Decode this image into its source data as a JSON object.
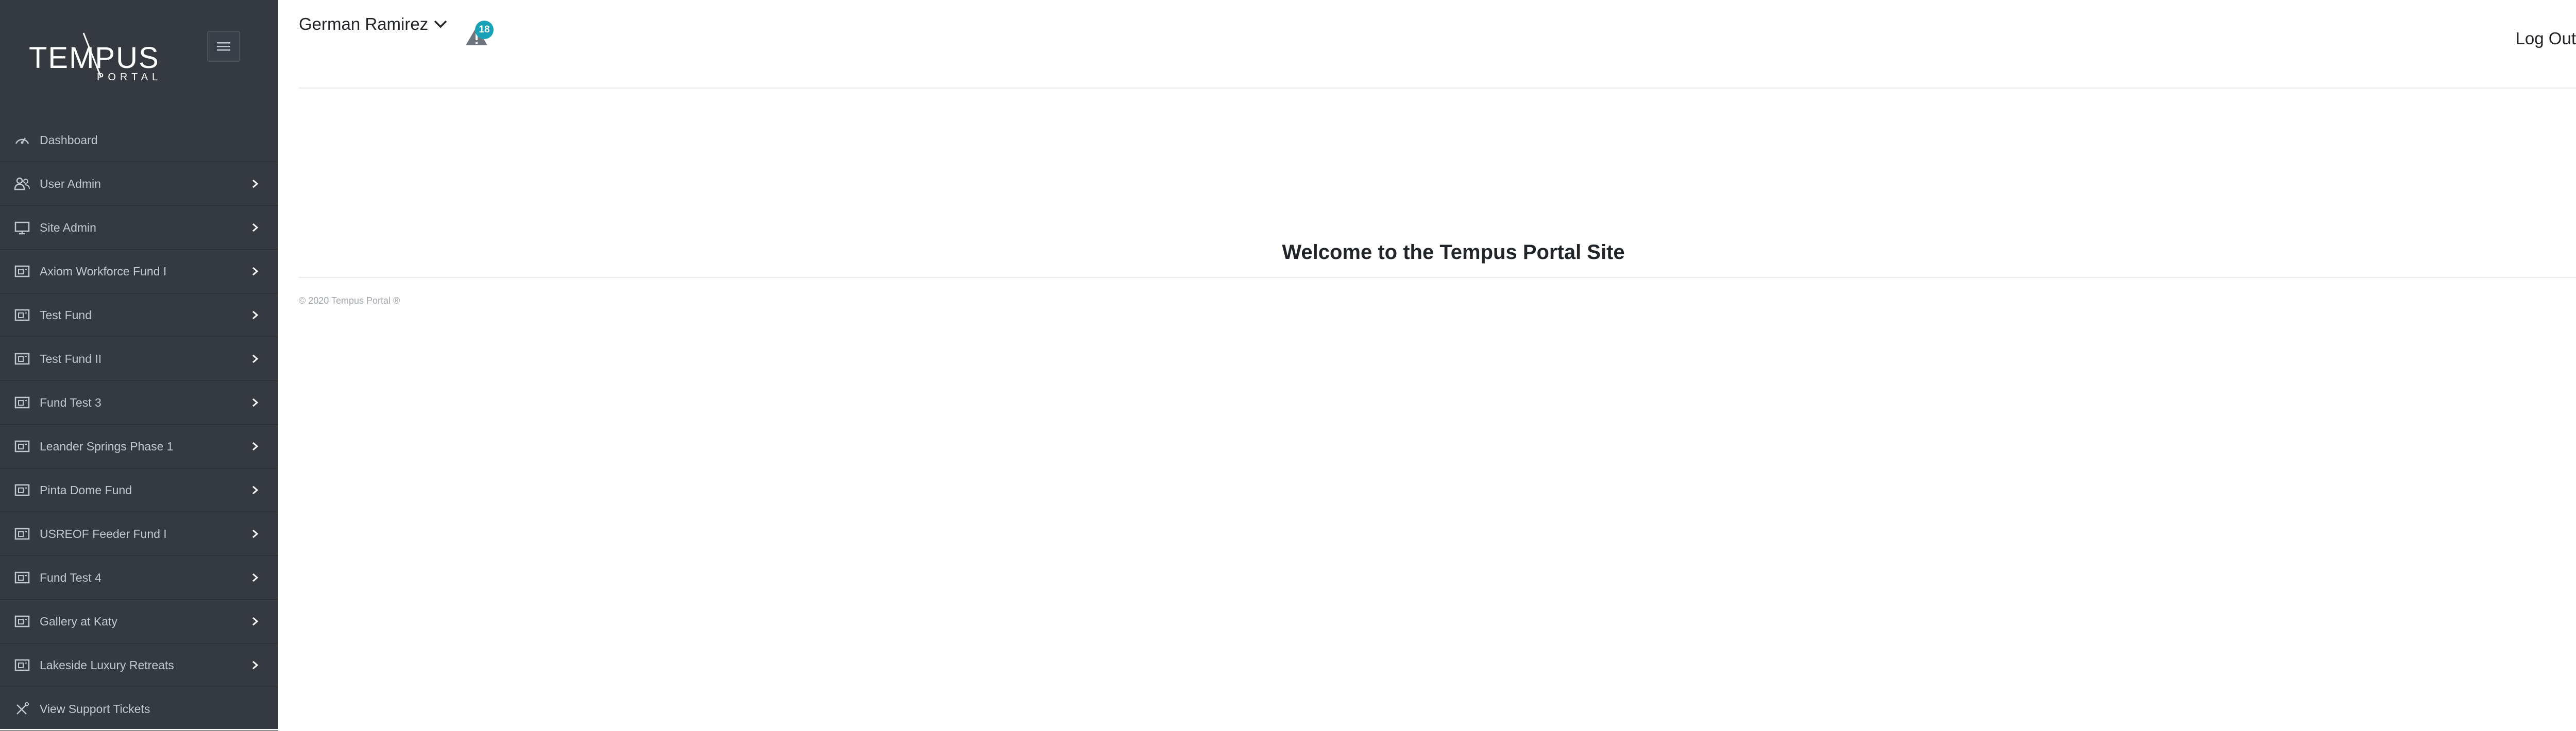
{
  "brand": {
    "logo_main": "TEMPUS",
    "logo_sub": "PORTAL"
  },
  "header": {
    "user_name": "German Ramirez",
    "alert_count": "18",
    "logout_label": "Log Out"
  },
  "sidebar": {
    "items": [
      {
        "label": "Dashboard",
        "icon": "speedometer-icon",
        "has_chevron": false
      },
      {
        "label": "User Admin",
        "icon": "users-icon",
        "has_chevron": true
      },
      {
        "label": "Site Admin",
        "icon": "monitor-icon",
        "has_chevron": true
      },
      {
        "label": "Axiom Workforce Fund I",
        "icon": "fund-box-icon",
        "has_chevron": true
      },
      {
        "label": "Test Fund",
        "icon": "fund-box-icon",
        "has_chevron": true
      },
      {
        "label": "Test Fund II",
        "icon": "fund-box-icon",
        "has_chevron": true
      },
      {
        "label": "Fund Test 3",
        "icon": "fund-box-icon",
        "has_chevron": true
      },
      {
        "label": "Leander Springs Phase 1",
        "icon": "fund-box-icon",
        "has_chevron": true
      },
      {
        "label": "Pinta Dome Fund",
        "icon": "fund-box-icon",
        "has_chevron": true
      },
      {
        "label": "USREOF Feeder Fund I",
        "icon": "fund-box-icon",
        "has_chevron": true
      },
      {
        "label": "Fund Test 4",
        "icon": "fund-box-icon",
        "has_chevron": true
      },
      {
        "label": "Gallery at Katy",
        "icon": "fund-box-icon",
        "has_chevron": true
      },
      {
        "label": "Lakeside Luxury Retreats",
        "icon": "fund-box-icon",
        "has_chevron": true
      },
      {
        "label": "View Support Tickets",
        "icon": "tools-icon",
        "has_chevron": false
      }
    ]
  },
  "main": {
    "welcome": "Welcome to the Tempus Portal Site",
    "footer": "© 2020 Tempus Portal ®"
  },
  "colors": {
    "sidebar_bg": "#343a40",
    "sidebar_text": "#c2c7d0",
    "badge": "#17a2b8"
  }
}
